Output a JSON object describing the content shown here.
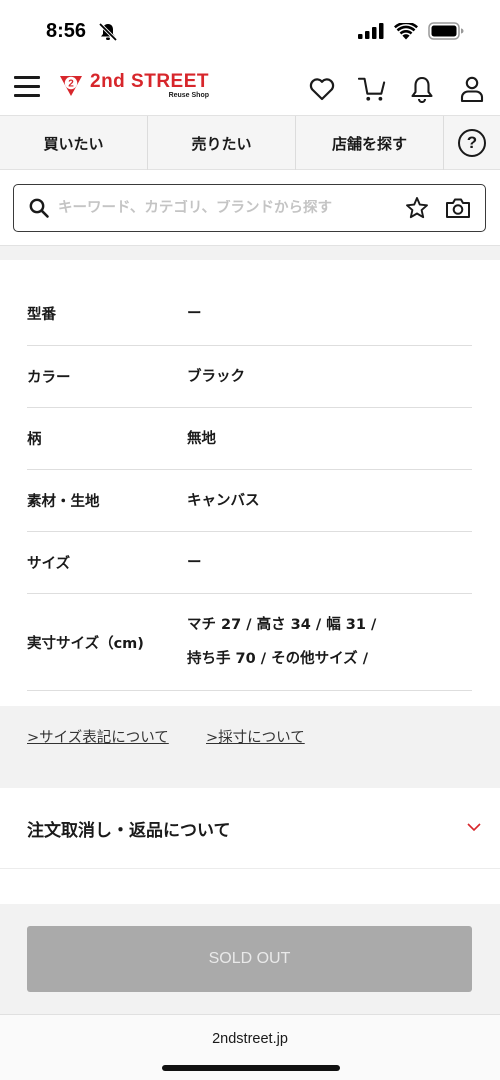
{
  "status_bar": {
    "time": "8:56",
    "icons": [
      "bell-slash-icon",
      "cellular-signal-icon",
      "wifi-icon",
      "battery-icon"
    ]
  },
  "header": {
    "logo_main": "2nd STREET",
    "logo_sub": "Reuse Shop",
    "logo_badge": "2",
    "brand_color": "#d7262b",
    "icons": [
      "menu-icon",
      "heart-icon",
      "cart-icon",
      "bell-icon",
      "user-icon"
    ]
  },
  "nav": {
    "tabs": [
      {
        "label": "買いたい"
      },
      {
        "label": "売りたい"
      },
      {
        "label": "店舗を探す"
      }
    ],
    "help_label": "?"
  },
  "search": {
    "placeholder": "キーワード、カテゴリ、ブランドから探す"
  },
  "specs": [
    {
      "label": "型番",
      "value": "ー"
    },
    {
      "label": "カラー",
      "value": "ブラック"
    },
    {
      "label": "柄",
      "value": "無地"
    },
    {
      "label": "素材・生地",
      "value": "キャンバス"
    },
    {
      "label": "サイズ",
      "value": "ー"
    },
    {
      "label": "実寸サイズ（cm)",
      "value_line1": "マチ 27 /  高さ 34 /  幅 31 /",
      "value_line2": "持ち手 70 /  その他サイズ /"
    }
  ],
  "size_links": {
    "notation": ">サイズ表記について",
    "measurement": ">採寸について"
  },
  "order": {
    "title": "注文取消し・返品について"
  },
  "soldout": {
    "label": "SOLD OUT"
  },
  "browser": {
    "url": "2ndstreet.jp"
  }
}
